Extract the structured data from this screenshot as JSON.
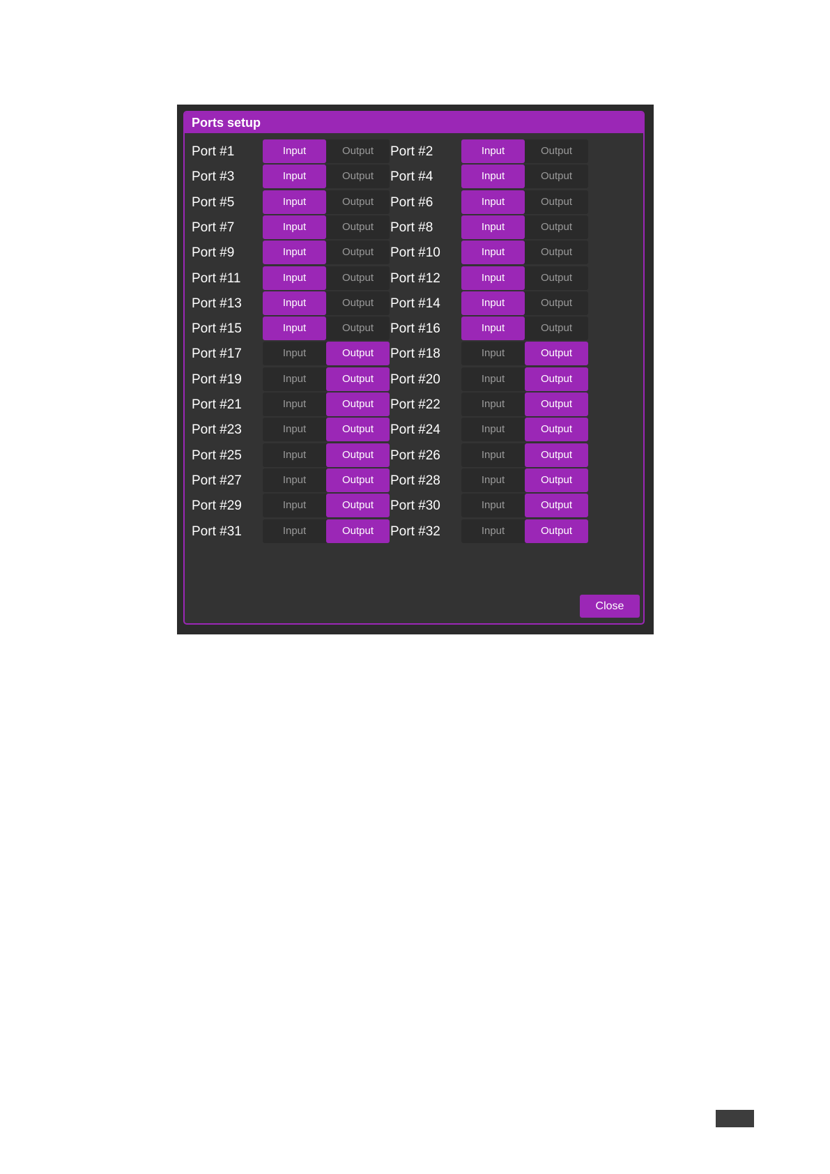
{
  "dialog": {
    "title": "Ports setup",
    "close_label": "Close"
  },
  "option_labels": {
    "input": "Input",
    "output": "Output"
  },
  "ports": [
    {
      "label": "Port #1",
      "mode": "input"
    },
    {
      "label": "Port #2",
      "mode": "input"
    },
    {
      "label": "Port #3",
      "mode": "input"
    },
    {
      "label": "Port #4",
      "mode": "input"
    },
    {
      "label": "Port #5",
      "mode": "input"
    },
    {
      "label": "Port #6",
      "mode": "input"
    },
    {
      "label": "Port #7",
      "mode": "input"
    },
    {
      "label": "Port #8",
      "mode": "input"
    },
    {
      "label": "Port #9",
      "mode": "input"
    },
    {
      "label": "Port #10",
      "mode": "input"
    },
    {
      "label": "Port #11",
      "mode": "input"
    },
    {
      "label": "Port #12",
      "mode": "input"
    },
    {
      "label": "Port #13",
      "mode": "input"
    },
    {
      "label": "Port #14",
      "mode": "input"
    },
    {
      "label": "Port #15",
      "mode": "input"
    },
    {
      "label": "Port #16",
      "mode": "input"
    },
    {
      "label": "Port #17",
      "mode": "output"
    },
    {
      "label": "Port #18",
      "mode": "output"
    },
    {
      "label": "Port #19",
      "mode": "output"
    },
    {
      "label": "Port #20",
      "mode": "output"
    },
    {
      "label": "Port #21",
      "mode": "output"
    },
    {
      "label": "Port #22",
      "mode": "output"
    },
    {
      "label": "Port #23",
      "mode": "output"
    },
    {
      "label": "Port #24",
      "mode": "output"
    },
    {
      "label": "Port #25",
      "mode": "output"
    },
    {
      "label": "Port #26",
      "mode": "output"
    },
    {
      "label": "Port #27",
      "mode": "output"
    },
    {
      "label": "Port #28",
      "mode": "output"
    },
    {
      "label": "Port #29",
      "mode": "output"
    },
    {
      "label": "Port #30",
      "mode": "output"
    },
    {
      "label": "Port #31",
      "mode": "output"
    },
    {
      "label": "Port #32",
      "mode": "output"
    }
  ],
  "colors": {
    "accent": "#9b27b6",
    "dialog_background": "#333333",
    "inactive_text": "#9a9a9a"
  }
}
